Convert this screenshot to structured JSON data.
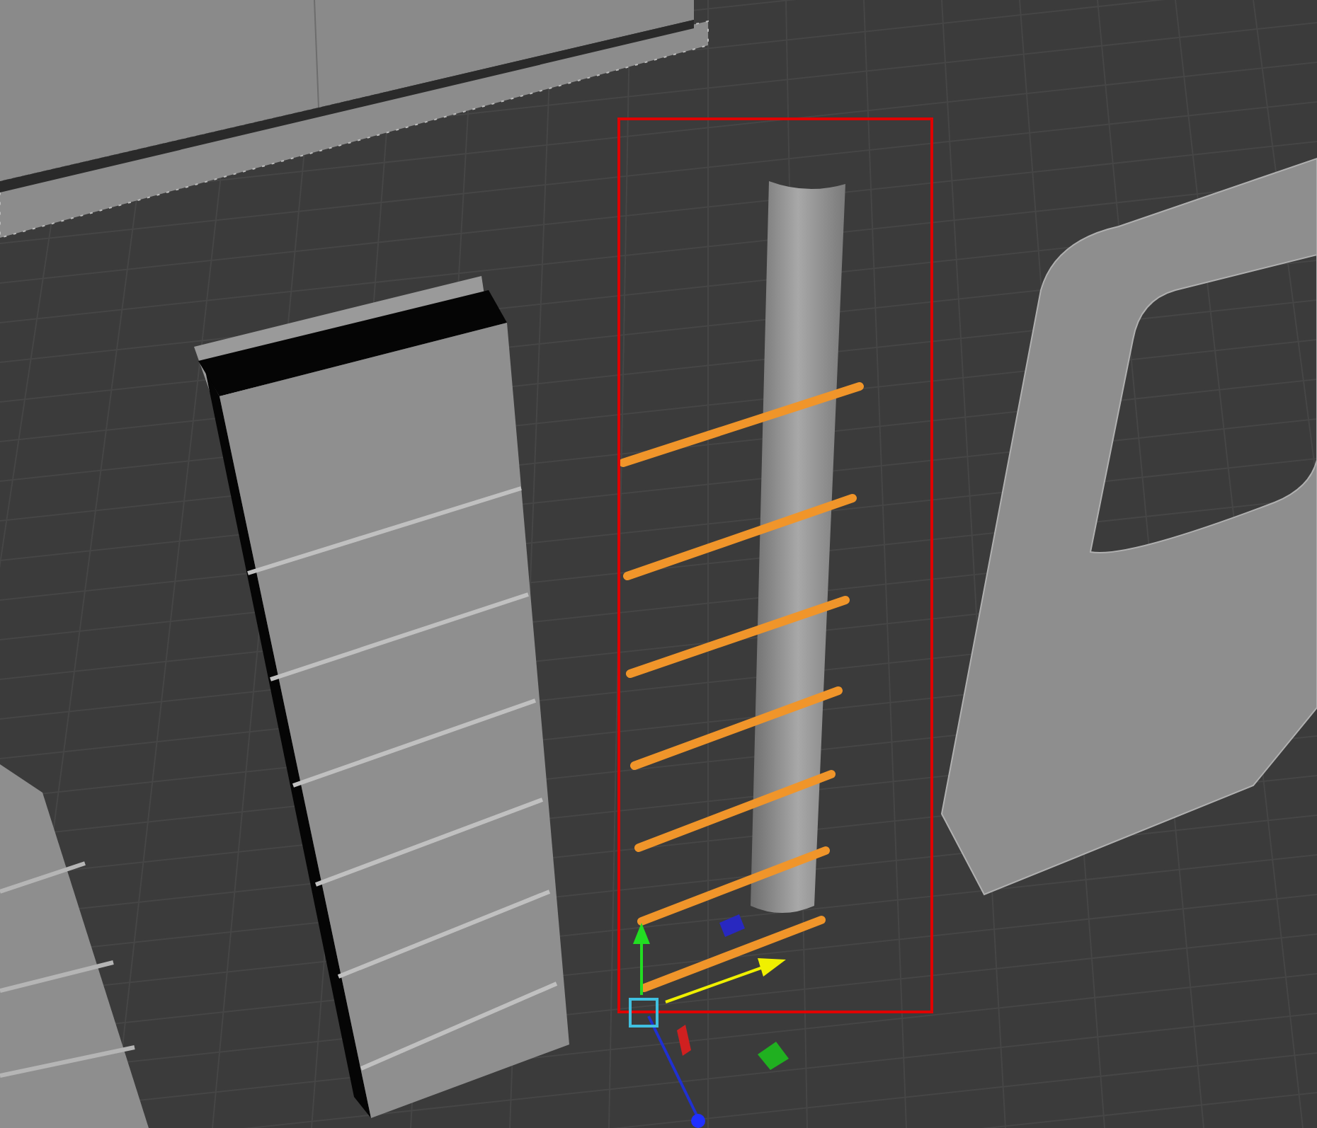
{
  "viewport": {
    "selection": {
      "kind": "frame"
    },
    "gizmo": {
      "kind": "move"
    }
  }
}
